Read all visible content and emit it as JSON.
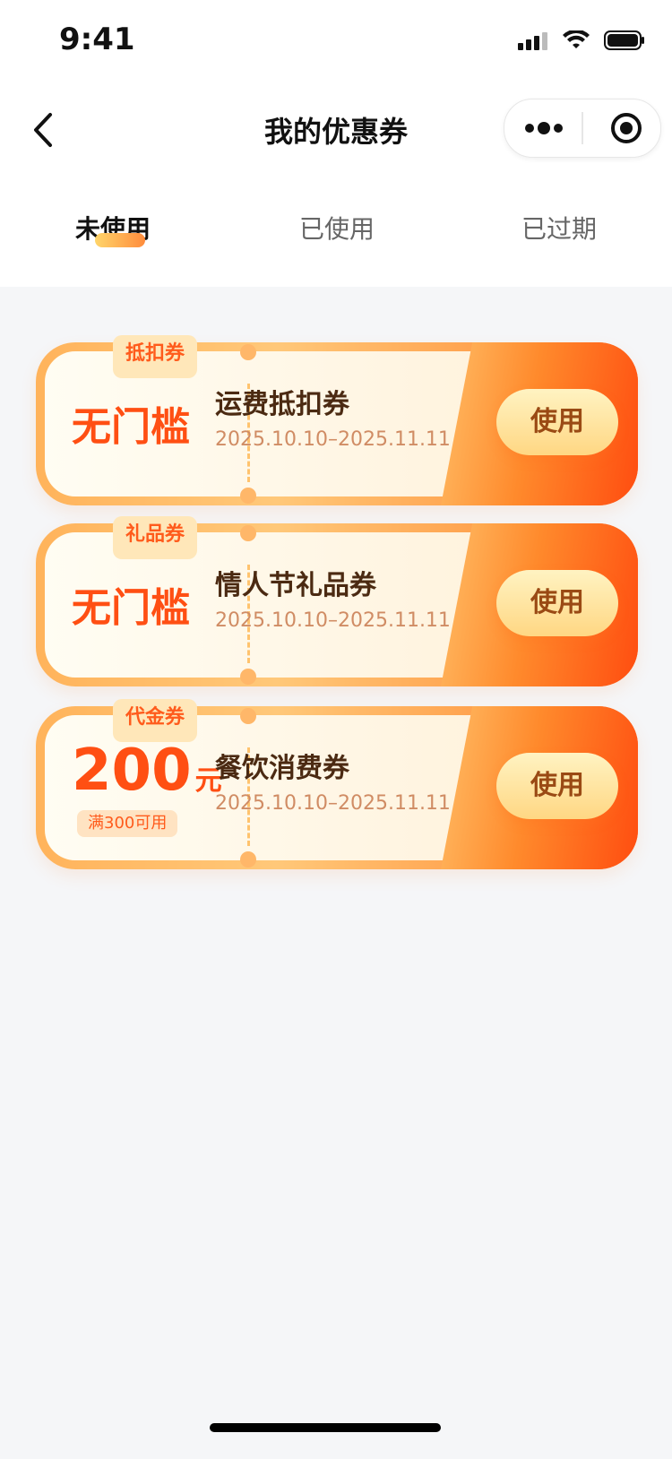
{
  "status_bar": {
    "time": "9:41"
  },
  "navbar": {
    "title": "我的优惠券"
  },
  "tabs": [
    {
      "label": "未使用",
      "active": true
    },
    {
      "label": "已使用",
      "active": false
    },
    {
      "label": "已过期",
      "active": false
    }
  ],
  "coupons": [
    {
      "badge": "抵扣券",
      "left_text": "无门槛",
      "title": "运费抵扣券",
      "date": "2025.10.10–2025.11.11",
      "button": "使用"
    },
    {
      "badge": "礼品券",
      "left_text": "无门槛",
      "title": "情人节礼品券",
      "date": "2025.10.10–2025.11.11",
      "button": "使用"
    },
    {
      "badge": "代金券",
      "amount": "200",
      "unit": "元",
      "condition": "满300可用",
      "title": "餐饮消费券",
      "date": "2025.10.10–2025.11.11",
      "button": "使用"
    }
  ],
  "colors": {
    "accent": "#ff4f13",
    "button_text": "#9a4a14",
    "title_text": "#4b2a12"
  },
  "icons": [
    "back-arrow-icon",
    "more-dots-icon",
    "target-icon",
    "signal-icon",
    "wifi-icon",
    "battery-icon"
  ]
}
